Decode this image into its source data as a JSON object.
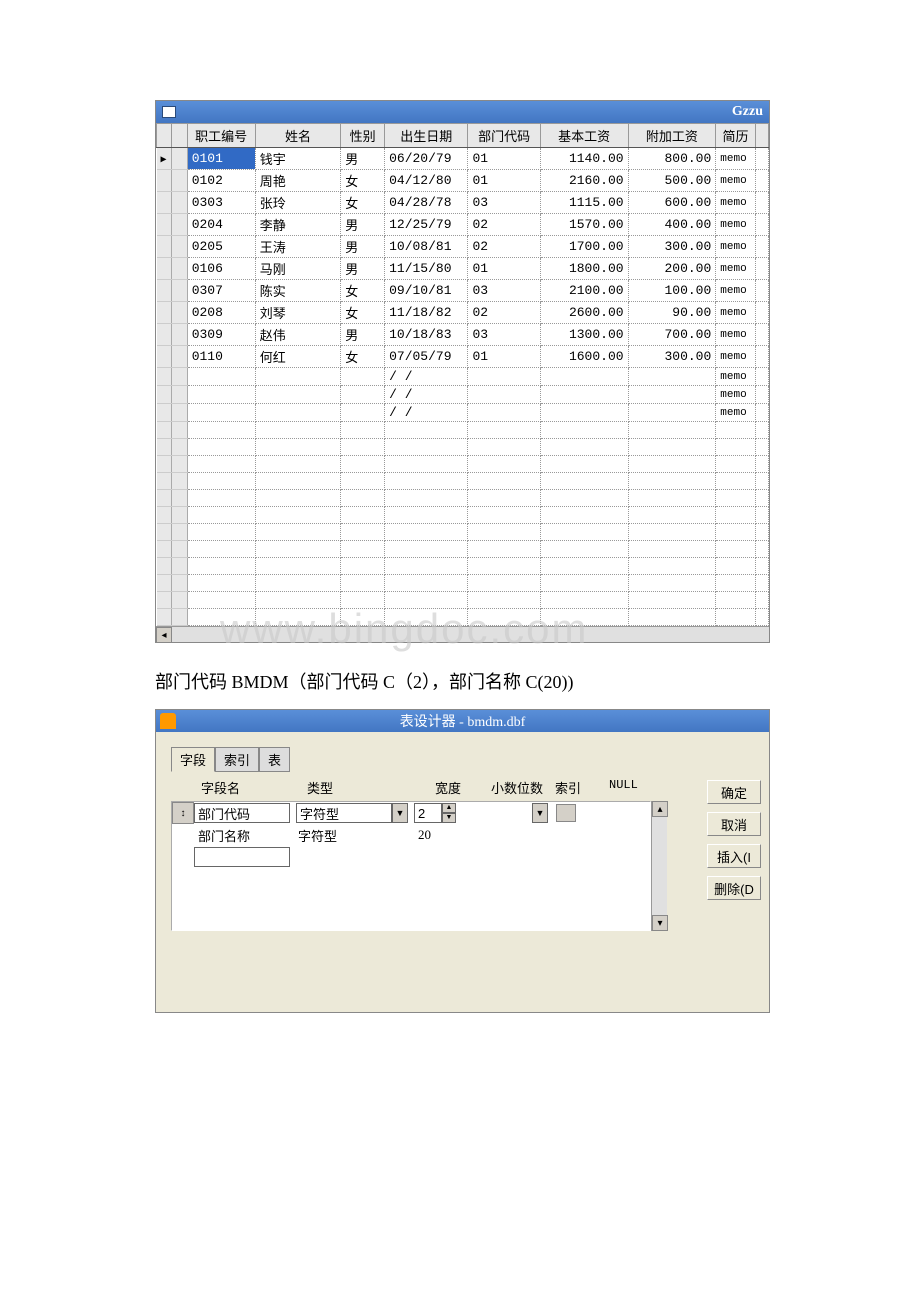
{
  "grid": {
    "title": "Gzzu",
    "columns": [
      "职工编号",
      "姓名",
      "性别",
      "出生日期",
      "部门代码",
      "基本工资",
      "附加工资",
      "简历"
    ],
    "rows": [
      {
        "id": "0101",
        "name": "钱宇",
        "sex": "男",
        "dob": "06/20/79",
        "dept": "01",
        "base": "1140.00",
        "extra": "800.00",
        "memo": "memo",
        "selected": true,
        "pointer": true
      },
      {
        "id": "0102",
        "name": "周艳",
        "sex": "女",
        "dob": "04/12/80",
        "dept": "01",
        "base": "2160.00",
        "extra": "500.00",
        "memo": "memo"
      },
      {
        "id": "0303",
        "name": "张玲",
        "sex": "女",
        "dob": "04/28/78",
        "dept": "03",
        "base": "1115.00",
        "extra": "600.00",
        "memo": "memo"
      },
      {
        "id": "0204",
        "name": "李静",
        "sex": "男",
        "dob": "12/25/79",
        "dept": "02",
        "base": "1570.00",
        "extra": "400.00",
        "memo": "memo"
      },
      {
        "id": "0205",
        "name": "王涛",
        "sex": "男",
        "dob": "10/08/81",
        "dept": "02",
        "base": "1700.00",
        "extra": "300.00",
        "memo": "memo"
      },
      {
        "id": "0106",
        "name": "马刚",
        "sex": "男",
        "dob": "11/15/80",
        "dept": "01",
        "base": "1800.00",
        "extra": "200.00",
        "memo": "memo"
      },
      {
        "id": "0307",
        "name": "陈实",
        "sex": "女",
        "dob": "09/10/81",
        "dept": "03",
        "base": "2100.00",
        "extra": "100.00",
        "memo": "memo"
      },
      {
        "id": "0208",
        "name": "刘琴",
        "sex": "女",
        "dob": "11/18/82",
        "dept": "02",
        "base": "2600.00",
        "extra": "90.00",
        "memo": "memo"
      },
      {
        "id": "0309",
        "name": "赵伟",
        "sex": "男",
        "dob": "10/18/83",
        "dept": "03",
        "base": "1300.00",
        "extra": "700.00",
        "memo": "memo"
      },
      {
        "id": "0110",
        "name": "何红",
        "sex": "女",
        "dob": "07/05/79",
        "dept": "01",
        "base": "1600.00",
        "extra": "300.00",
        "memo": "memo"
      },
      {
        "id": "",
        "name": "",
        "sex": "",
        "dob": "/  /",
        "dept": "",
        "base": "",
        "extra": "",
        "memo": "memo"
      },
      {
        "id": "",
        "name": "",
        "sex": "",
        "dob": "/  /",
        "dept": "",
        "base": "",
        "extra": "",
        "memo": "memo"
      },
      {
        "id": "",
        "name": "",
        "sex": "",
        "dob": "/  /",
        "dept": "",
        "base": "",
        "extra": "",
        "memo": "memo"
      }
    ]
  },
  "caption": "部门代码 BMDM（部门代码 C（2），部门名称 C(20))",
  "watermark": "www.bingdoc.com",
  "designer": {
    "title": "表设计器 - bmdm.dbf",
    "tabs": [
      "字段",
      "索引",
      "表"
    ],
    "headers": {
      "name": "字段名",
      "type": "类型",
      "width": "宽度",
      "dec": "小数位数",
      "index": "索引",
      "null": "NULL"
    },
    "fields": [
      {
        "name": "部门代码",
        "type": "字符型",
        "width": "2",
        "active": true
      },
      {
        "name": "部门名称",
        "type": "字符型",
        "width": "20"
      }
    ],
    "buttons": {
      "ok": "确定",
      "cancel": "取消",
      "insert": "插入(I",
      "delete": "删除(D"
    }
  }
}
